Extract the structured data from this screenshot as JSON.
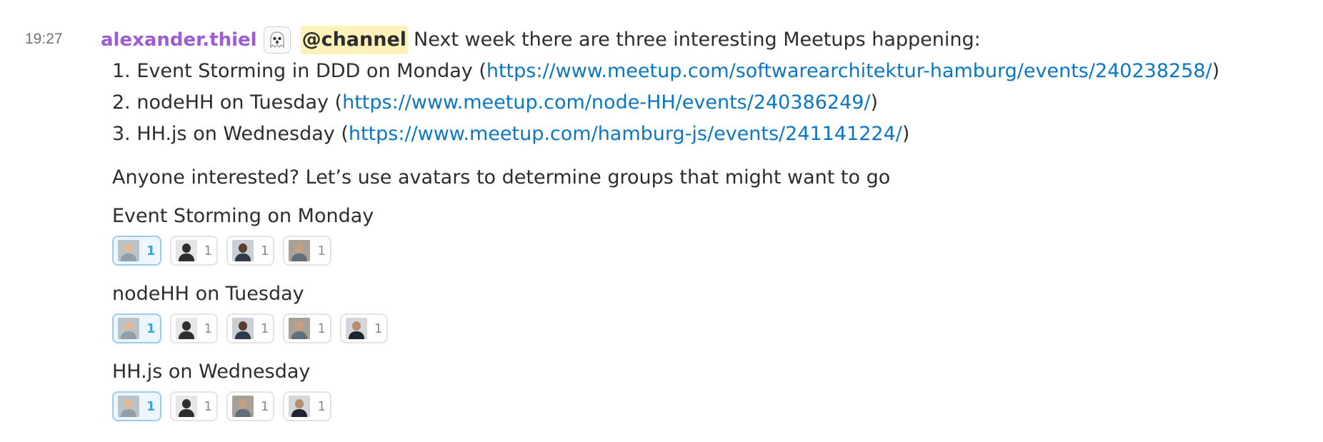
{
  "message": {
    "timestamp": "19:27",
    "author": "alexander.thiel",
    "badge_icon": "ghost-icon",
    "mention": "@channel",
    "intro": "Next week there are three interesting Meetups happening:",
    "items": [
      {
        "prefix": "1. Event Storming in DDD on Monday (",
        "url": "https://www.meetup.com/softwarearchitektur-hamburg/events/240238258/",
        "suffix": ")"
      },
      {
        "prefix": "2. nodeHH on Tuesday (",
        "url": "https://www.meetup.com/node-HH/events/240386249/",
        "suffix": ")"
      },
      {
        "prefix": "3. HH.js on Wednesday (",
        "url": "https://www.meetup.com/hamburg-js/events/241141224/",
        "suffix": ")"
      }
    ],
    "question": "Anyone interested? Let’s use avatars to determine groups that might want to go",
    "groups": [
      {
        "title": "Event Storming on Monday",
        "reactions": [
          {
            "avatar": "avatar-blond-man",
            "count": "1",
            "active": true
          },
          {
            "avatar": "avatar-silhouette",
            "count": "1",
            "active": false
          },
          {
            "avatar": "avatar-dark-man",
            "count": "1",
            "active": false
          },
          {
            "avatar": "avatar-man-office",
            "count": "1",
            "active": false
          }
        ]
      },
      {
        "title": "nodeHH on Tuesday",
        "reactions": [
          {
            "avatar": "avatar-blond-man",
            "count": "1",
            "active": true
          },
          {
            "avatar": "avatar-silhouette",
            "count": "1",
            "active": false
          },
          {
            "avatar": "avatar-dark-man",
            "count": "1",
            "active": false
          },
          {
            "avatar": "avatar-man-office",
            "count": "1",
            "active": false
          },
          {
            "avatar": "avatar-bearded-man",
            "count": "1",
            "active": false
          }
        ]
      },
      {
        "title": "HH.js on Wednesday",
        "reactions": [
          {
            "avatar": "avatar-blond-man",
            "count": "1",
            "active": true
          },
          {
            "avatar": "avatar-silhouette",
            "count": "1",
            "active": false
          },
          {
            "avatar": "avatar-man-office",
            "count": "1",
            "active": false
          },
          {
            "avatar": "avatar-bearded-man",
            "count": "1",
            "active": false
          }
        ]
      }
    ]
  }
}
